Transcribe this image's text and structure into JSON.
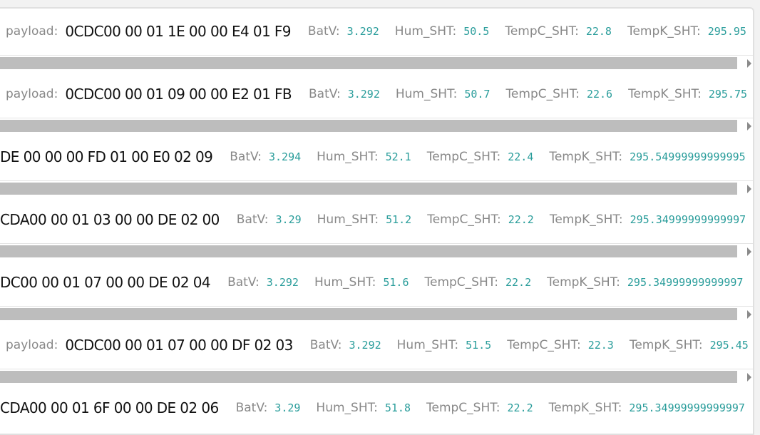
{
  "labels": {
    "payload": "payload:",
    "batv": "BatV:",
    "hum": "Hum_SHT:",
    "tempc": "TempC_SHT:",
    "tempk": "TempK_SHT:"
  },
  "rows": [
    {
      "payload": "0CDC00 00 01 1E 00 00 E4 01 F9",
      "batv": "3.292",
      "hum": "50.5",
      "tempc": "22.8",
      "tempk": "295.95"
    },
    {
      "payload": "0CDC00 00 01 09 00 00 E2 01 FB",
      "batv": "3.292",
      "hum": "50.7",
      "tempc": "22.6",
      "tempk": "295.75"
    },
    {
      "payload": "DE 00 00 00 FD 01 00 E0 02 09",
      "batv": "3.294",
      "hum": "52.1",
      "tempc": "22.4",
      "tempk": "295.54999999999995"
    },
    {
      "payload": "CDA00 00 01 03 00 00 DE 02 00",
      "batv": "3.29",
      "hum": "51.2",
      "tempc": "22.2",
      "tempk": "295.34999999999997"
    },
    {
      "payload": "DC00 00 01 07 00 00 DE 02 04",
      "batv": "3.292",
      "hum": "51.6",
      "tempc": "22.2",
      "tempk": "295.34999999999997"
    },
    {
      "payload": "0CDC00 00 01 07 00 00 DF 02 03",
      "batv": "3.292",
      "hum": "51.5",
      "tempc": "22.3",
      "tempk": "295.45"
    },
    {
      "payload": "CDA00 00 01 6F 00 00 DE 02 06",
      "batv": "3.29",
      "hum": "51.8",
      "tempc": "22.2",
      "tempk": "295.34999999999997"
    }
  ],
  "colors": {
    "label": "#888888",
    "value": "#2a9d9b",
    "payload": "#111111",
    "scrollbar": "#bdbdbd"
  }
}
